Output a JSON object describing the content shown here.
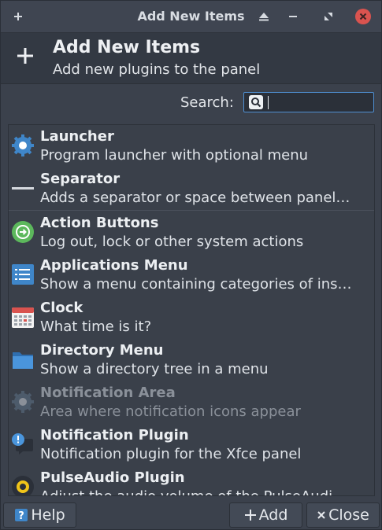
{
  "window": {
    "title": "Add New Items"
  },
  "header": {
    "title": "Add New Items",
    "subtitle": "Add new plugins to the panel"
  },
  "search": {
    "label": "Search:",
    "value": ""
  },
  "items": [
    {
      "name": "Launcher",
      "description": "Program launcher with optional menu",
      "icon": "gear-icon",
      "enabled": true
    },
    {
      "name": "Separator",
      "description": "Adds a separator or space between panel…",
      "icon": "separator-icon",
      "enabled": true
    },
    {
      "name": "Action Buttons",
      "description": "Log out, lock or other system actions",
      "icon": "action-buttons-icon",
      "enabled": true
    },
    {
      "name": "Applications Menu",
      "description": "Show a menu containing categories of ins…",
      "icon": "applications-menu-icon",
      "enabled": true
    },
    {
      "name": "Clock",
      "description": "What time is it?",
      "icon": "calendar-icon",
      "enabled": true
    },
    {
      "name": "Directory Menu",
      "description": "Show a directory tree in a menu",
      "icon": "folder-icon",
      "enabled": true
    },
    {
      "name": "Notification Area",
      "description": "Area where notification icons appear",
      "icon": "gear-icon",
      "enabled": false
    },
    {
      "name": "Notification Plugin",
      "description": "Notification plugin for the Xfce panel",
      "icon": "notification-icon",
      "enabled": true
    },
    {
      "name": "PulseAudio Plugin",
      "description": "Adjust the audio volume of the PulseAudi…",
      "icon": "audio-icon",
      "enabled": true
    }
  ],
  "buttons": {
    "help": "Help",
    "add": "Add",
    "close": "Close"
  },
  "colors": {
    "accent": "#4f8fd1",
    "close_red": "#d9534f",
    "action_green": "#5cb85c"
  }
}
